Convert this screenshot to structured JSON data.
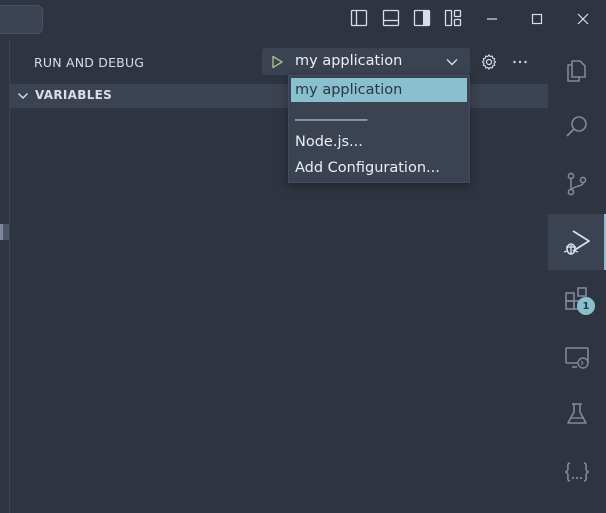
{
  "colors": {
    "background": "#2e3440",
    "panel": "#3b4252",
    "accent": "#88c0d0",
    "foreground": "#d8dee9",
    "run_icon": "#a3be8c"
  },
  "titlebar": {
    "layout_icons": [
      "toggle-primary-sidebar-icon",
      "toggle-panel-icon",
      "toggle-secondary-sidebar-icon",
      "customize-layout-icon"
    ],
    "window_controls": [
      "minimize-icon",
      "maximize-icon",
      "close-icon"
    ]
  },
  "debug": {
    "title": "RUN AND DEBUG",
    "launch_config": "my application",
    "start_icon": "play-icon",
    "settings_icon": "gear-icon",
    "more_icon": "ellipsis-icon"
  },
  "variables": {
    "title": "VARIABLES"
  },
  "dropdown": {
    "options": [
      {
        "label": "my application",
        "selected": true
      },
      {
        "label": "──────────",
        "separator": true
      },
      {
        "label": "Node.js..."
      },
      {
        "label": "Add Configuration..."
      }
    ]
  },
  "activitybar": {
    "items": [
      {
        "name": "explorer-icon"
      },
      {
        "name": "search-icon"
      },
      {
        "name": "source-control-icon"
      },
      {
        "name": "run-and-debug-icon",
        "active": true
      },
      {
        "name": "extensions-icon",
        "badge": "1"
      },
      {
        "name": "remote-explorer-icon"
      },
      {
        "name": "testing-icon"
      },
      {
        "name": "json-icon"
      }
    ]
  }
}
